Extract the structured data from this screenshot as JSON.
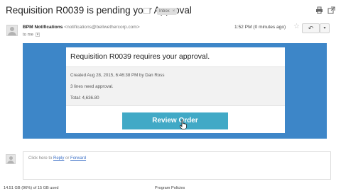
{
  "subject": "Requisition R0039 is pending your Approval",
  "label_chip": "Inbox",
  "header_icons": {
    "print": "print-icon",
    "new_window": "open-in-new-window-icon"
  },
  "sender": {
    "name": "BPM Notifications",
    "email": "<notifications@bellwethercorp.com>",
    "to": "to me"
  },
  "time": "1:52 PM (0 minutes ago)",
  "card": {
    "title": "Requisition R0039 requires your approval.",
    "created": "Created Aug 28, 2015, 6:46:38 PM by Dan Ross",
    "lines": "3 lines need approval.",
    "total": "Total: 4,636.80",
    "button": "Review Order"
  },
  "reply": {
    "prefix": "Click here to ",
    "reply_link": "Reply",
    "middle": " or ",
    "forward_link": "Forward"
  },
  "footer": {
    "storage": "14.51 GB (96%) of 15 GB used",
    "policies": "Program Policies"
  },
  "colors": {
    "panel": "#3d86c8",
    "button": "#41a9c6"
  }
}
